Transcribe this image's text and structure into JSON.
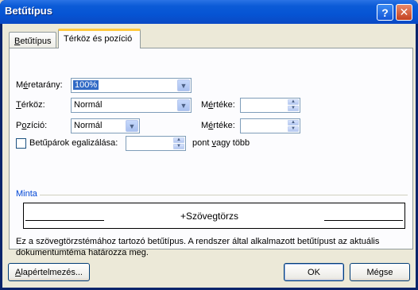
{
  "window": {
    "title": "Betűtípus",
    "help_glyph": "?",
    "close_glyph": "✕"
  },
  "tabs": [
    {
      "label_accel": "B",
      "label_rest": "etűtípus",
      "selected": false
    },
    {
      "label": "Térköz és pozíció",
      "selected": true
    }
  ],
  "fields": {
    "scale": {
      "label_pre": "M",
      "label_accel": "é",
      "label_post": "retarány:",
      "value": "100%"
    },
    "spacing": {
      "label_accel": "T",
      "label_post": "érköz:",
      "value": "Normál",
      "by_label_pre": "M",
      "by_label_accel": "é",
      "by_label_post": "rtéke:",
      "by_value": ""
    },
    "position": {
      "label_pre": "P",
      "label_accel": "o",
      "label_post": "zíció:",
      "value": "Normál",
      "by_label_pre": "M",
      "by_label_accel": "é",
      "by_label_post": "rtéke:",
      "by_value": ""
    },
    "kerning": {
      "label_pre": "Betűpárok e",
      "label_accel": "g",
      "label_post": "alizálása:",
      "checked": false,
      "value": "",
      "suffix_pre": "pont ",
      "suffix_accel": "v",
      "suffix_post": "agy több"
    }
  },
  "preview": {
    "group_label": "Minta",
    "sample_text": "+Szövegtörzs",
    "description": "Ez a szövegtörzstémához tartozó betűtípus. A rendszer által alkalmazott betűtípust az aktuális dokumentumtéma határozza meg."
  },
  "buttons": {
    "default_label_accel": "A",
    "default_label_rest": "lapértelmezés...",
    "ok": "OK",
    "cancel": "Mégse"
  },
  "colors": {
    "titlebar": "#0654d4",
    "group_label": "#0046d5",
    "selection": "#316ac5",
    "tab_highlight": "#ffc83c"
  }
}
